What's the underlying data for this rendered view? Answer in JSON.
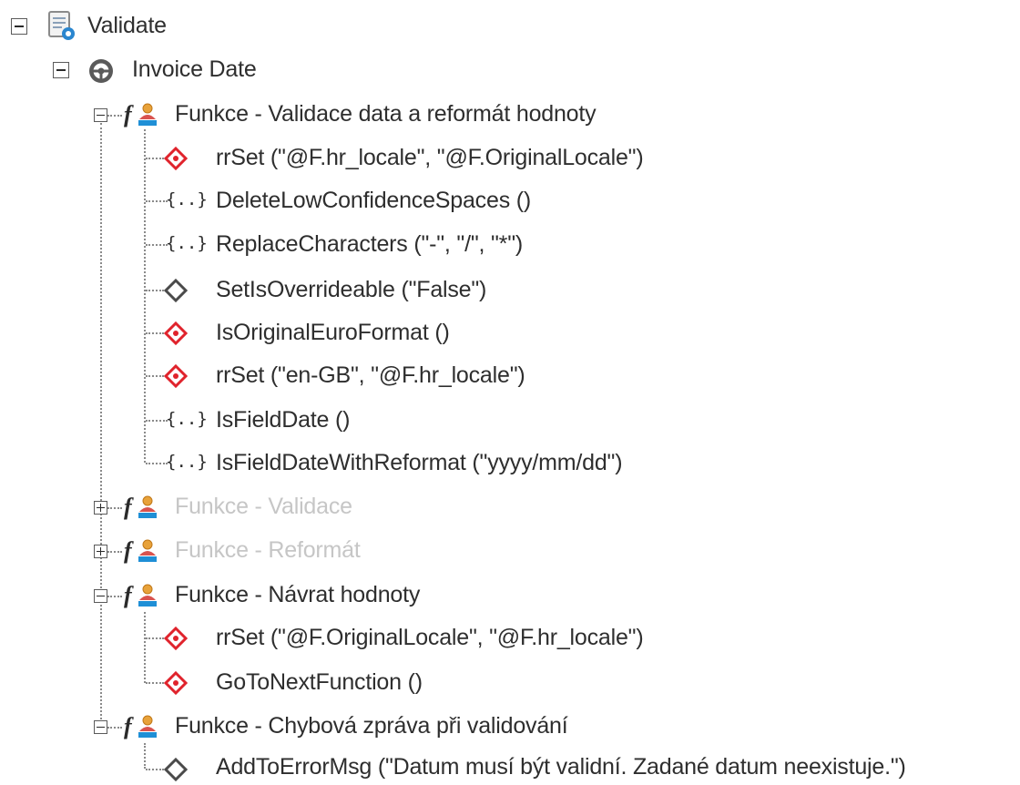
{
  "tree": {
    "root": {
      "label": "Validate",
      "icon": "validate-script-icon"
    },
    "field": {
      "label": "Invoice Date",
      "icon": "steering-wheel-icon"
    },
    "functions": [
      {
        "label": "Funkce - Validace data a reformát hodnoty",
        "expanded": true,
        "disabled": false,
        "icon": "function-user-icon",
        "children": [
          {
            "label": "rrSet (\"@F.hr_locale\", \"@F.OriginalLocale\")",
            "icon": "red-diamond-icon"
          },
          {
            "label": "DeleteLowConfidenceSpaces ()",
            "icon": "braces-icon"
          },
          {
            "label": "ReplaceCharacters (\"-\", \"/\", \"*\")",
            "icon": "braces-icon"
          },
          {
            "label": "SetIsOverrideable (\"False\")",
            "icon": "gray-diamond-icon"
          },
          {
            "label": "IsOriginalEuroFormat ()",
            "icon": "red-diamond-icon"
          },
          {
            "label": "rrSet (\"en-GB\", \"@F.hr_locale\")",
            "icon": "red-diamond-icon"
          },
          {
            "label": "IsFieldDate ()",
            "icon": "braces-icon"
          },
          {
            "label": "IsFieldDateWithReformat (\"yyyy/mm/dd\")",
            "icon": "braces-icon"
          }
        ]
      },
      {
        "label": "Funkce - Validace",
        "expanded": false,
        "disabled": true,
        "icon": "function-user-icon"
      },
      {
        "label": "Funkce - Reformát",
        "expanded": false,
        "disabled": true,
        "icon": "function-user-icon"
      },
      {
        "label": "Funkce - Návrat hodnoty",
        "expanded": true,
        "disabled": false,
        "icon": "function-user-icon",
        "children": [
          {
            "label": "rrSet (\"@F.OriginalLocale\", \"@F.hr_locale\")",
            "icon": "red-diamond-icon"
          },
          {
            "label": "GoToNextFunction ()",
            "icon": "red-diamond-icon"
          }
        ]
      },
      {
        "label": "Funkce - Chybová zpráva při validování",
        "expanded": true,
        "disabled": false,
        "icon": "function-user-icon",
        "children": [
          {
            "label": "AddToErrorMsg (\"Datum musí být validní. Zadané datum neexistuje.\")",
            "icon": "gray-diamond-icon"
          }
        ]
      }
    ]
  },
  "colors": {
    "red_diamond": "#e0232c",
    "gray_diamond": "#4a4a4a",
    "disabled_text": "#c6c6c6",
    "text": "#2e2e2e",
    "function_f": "#2a2a2a",
    "function_person": "#e8a23a",
    "function_base": "#1f8fd6"
  }
}
